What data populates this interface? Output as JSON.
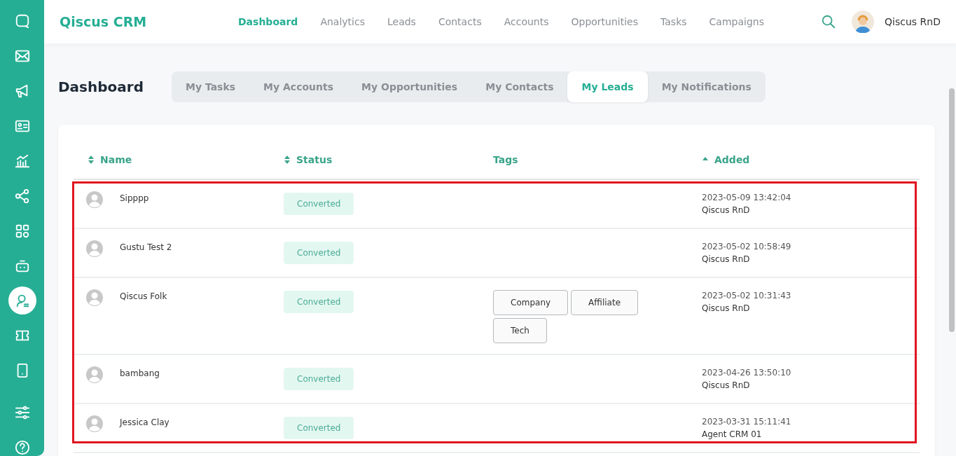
{
  "sidebar": {
    "items": [
      {
        "kind": "chat",
        "selected": false
      },
      {
        "kind": "mail",
        "selected": false
      },
      {
        "kind": "megaphone",
        "selected": false
      },
      {
        "kind": "contact-card",
        "selected": false
      },
      {
        "kind": "chart",
        "selected": false
      },
      {
        "kind": "share",
        "selected": false
      },
      {
        "kind": "apps",
        "selected": false
      },
      {
        "kind": "robot",
        "selected": false
      },
      {
        "kind": "agent",
        "selected": true
      },
      {
        "kind": "ticket",
        "selected": false
      },
      {
        "kind": "tablet",
        "selected": false
      },
      {
        "kind": "sliders",
        "selected": false
      },
      {
        "kind": "help",
        "selected": false
      }
    ]
  },
  "header": {
    "brand": "Qiscus CRM",
    "nav": [
      {
        "label": "Dashboard",
        "selected": true
      },
      {
        "label": "Analytics",
        "selected": false
      },
      {
        "label": "Leads",
        "selected": false
      },
      {
        "label": "Contacts",
        "selected": false
      },
      {
        "label": "Accounts",
        "selected": false
      },
      {
        "label": "Opportunities",
        "selected": false
      },
      {
        "label": "Tasks",
        "selected": false
      },
      {
        "label": "Campaigns",
        "selected": false
      }
    ],
    "user": "Qiscus RnD"
  },
  "page_title": "Dashboard",
  "tabs": [
    {
      "label": "My Tasks",
      "selected": false
    },
    {
      "label": "My Accounts",
      "selected": false
    },
    {
      "label": "My Opportunities",
      "selected": false
    },
    {
      "label": "My Contacts",
      "selected": false
    },
    {
      "label": "My Leads",
      "selected": true
    },
    {
      "label": "My Notifications",
      "selected": false
    }
  ],
  "table": {
    "columns": [
      {
        "label": "Name",
        "sortable": true,
        "sorted": false
      },
      {
        "label": "Status",
        "sortable": true,
        "sorted": false
      },
      {
        "label": "Tags",
        "sortable": false,
        "sorted": false
      },
      {
        "label": "Added",
        "sortable": true,
        "sorted": true
      }
    ],
    "rows": [
      {
        "name": "Sipppp",
        "status": "Converted",
        "tags": [],
        "added": "2023-05-09 13:42:04",
        "added_by": "Qiscus RnD"
      },
      {
        "name": "Gustu Test 2",
        "status": "Converted",
        "tags": [],
        "added": "2023-05-02 10:58:49",
        "added_by": "Qiscus RnD"
      },
      {
        "name": "Qiscus Folk",
        "status": "Converted",
        "tags": [
          "Company",
          "Affiliate",
          "Tech"
        ],
        "added": "2023-05-02 10:31:43",
        "added_by": "Qiscus RnD"
      },
      {
        "name": "bambang",
        "status": "Converted",
        "tags": [],
        "added": "2023-04-26 13:50:10",
        "added_by": "Qiscus RnD"
      },
      {
        "name": "Jessica Clay",
        "status": "Converted",
        "tags": [],
        "added": "2023-03-31 15:11:41",
        "added_by": "Agent CRM 01"
      }
    ],
    "highlighted": true
  }
}
